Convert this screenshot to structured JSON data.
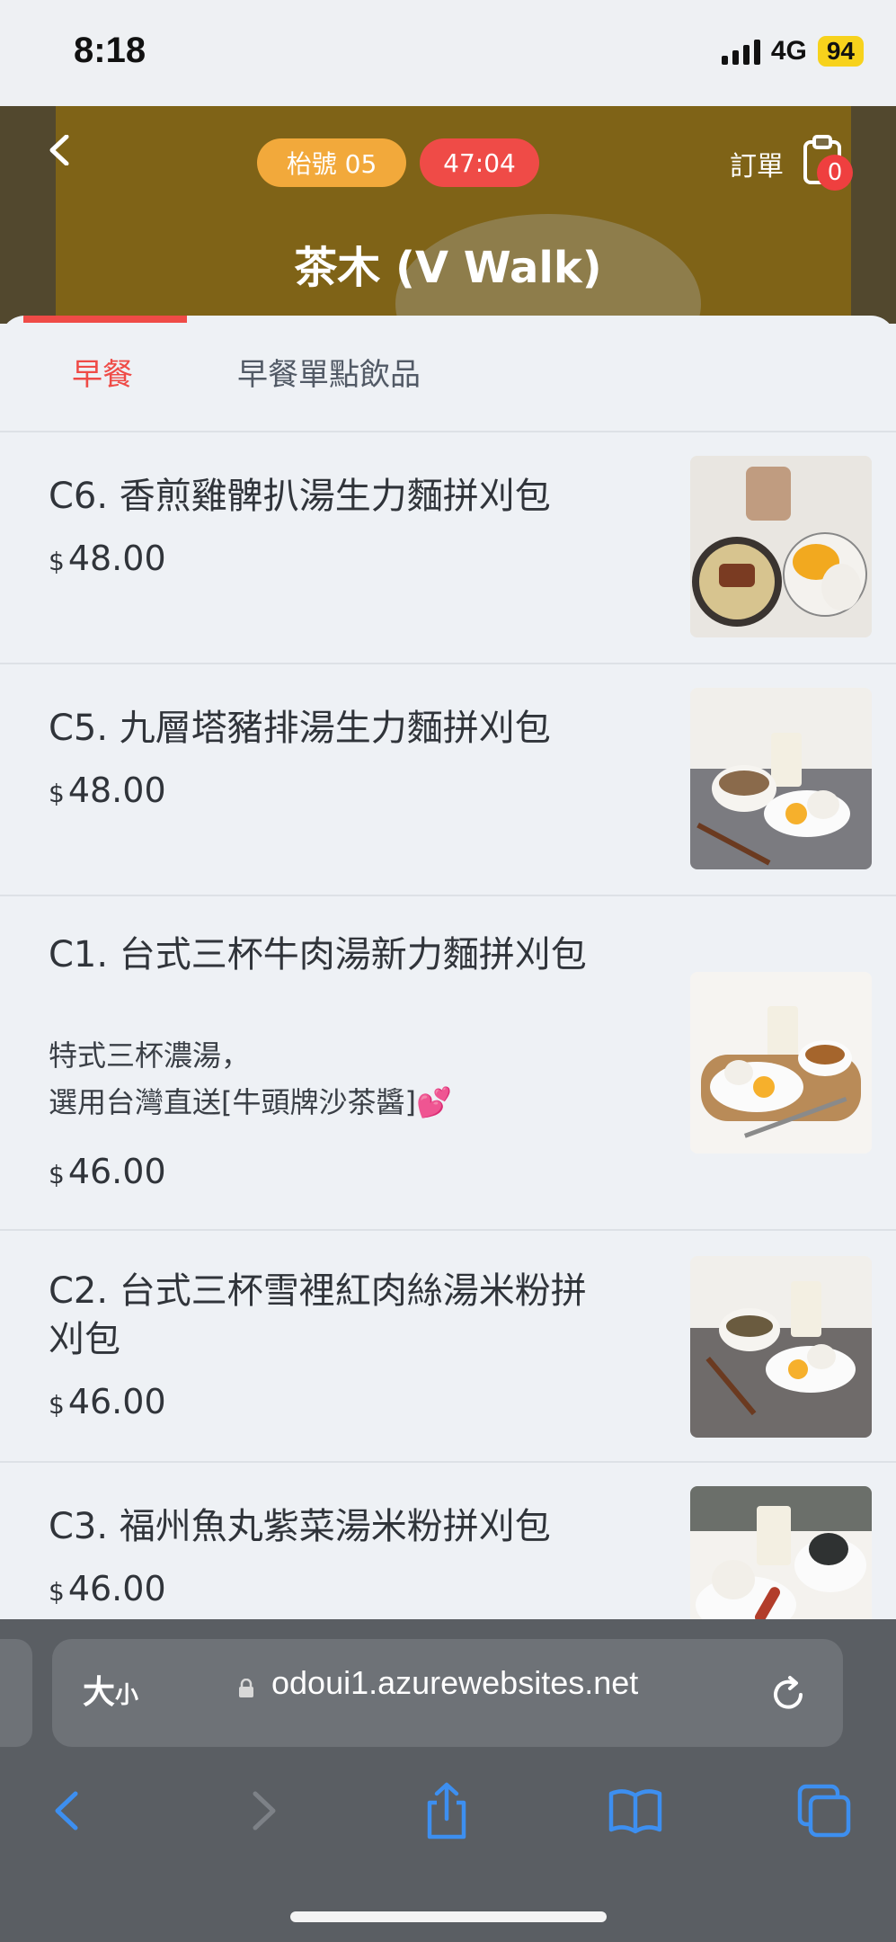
{
  "status_bar": {
    "time": "8:18",
    "network": "4G",
    "battery": "94"
  },
  "header": {
    "table_number": "枱號 05",
    "timer": "47:04",
    "order_label": "訂單",
    "order_count": "0",
    "store_name": "茶木 (V Walk)"
  },
  "tabs": [
    {
      "label": "早餐",
      "active": true
    },
    {
      "label": "早餐單點飲品",
      "active": false
    }
  ],
  "currency": "$",
  "items": [
    {
      "name": "C6. 香煎雞髀扒湯生力麵拼刈包",
      "price": "48.00"
    },
    {
      "name": "C5. 九層塔豬排湯生力麵拼刈包",
      "price": "48.00"
    },
    {
      "name": "C1. 台式三杯牛肉湯新力麵拼刈包",
      "desc1": "特式三杯濃湯，",
      "desc2": " 選用台灣直送[牛頭牌沙茶醬]💕",
      "price": "46.00"
    },
    {
      "name": "C2. 台式三杯雪裡紅肉絲湯米粉拼刈包",
      "price": "46.00"
    },
    {
      "name": "C3. 福州魚丸紫菜湯米粉拼刈包",
      "price": "46.00"
    }
  ],
  "browser": {
    "text_size": "大",
    "text_size_small": "小",
    "url": "odoui1.azurewebsites.net"
  },
  "colors": {
    "accent": "#ef4b47",
    "table_pill": "#f2a93b",
    "ios_blue": "#3d8ff0"
  }
}
